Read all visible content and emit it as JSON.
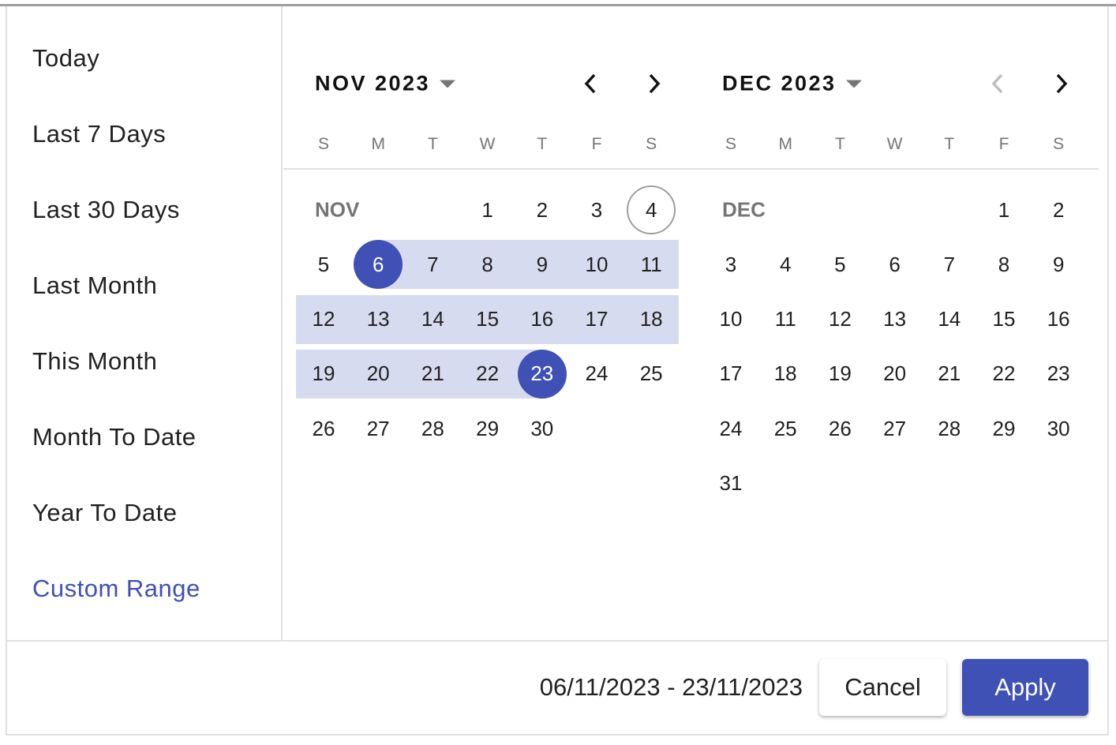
{
  "presets": [
    "Today",
    "Last 7 Days",
    "Last 30 Days",
    "Last Month",
    "This Month",
    "Month To Date",
    "Year To Date",
    "Custom Range"
  ],
  "active_preset": "Custom Range",
  "weekdays": [
    "S",
    "M",
    "T",
    "W",
    "T",
    "F",
    "S"
  ],
  "months": [
    {
      "title": "NOV 2023",
      "label": "NOV",
      "first_weekday": 3,
      "days": 30,
      "prev_enabled": true,
      "next_enabled": true
    },
    {
      "title": "DEC 2023",
      "label": "DEC",
      "first_weekday": 5,
      "days": 31,
      "prev_enabled": false,
      "next_enabled": true
    }
  ],
  "selection": {
    "month": "NOV 2023",
    "start": 6,
    "end": 23,
    "today": 4
  },
  "footer": {
    "range_text": "06/11/2023 - 23/11/2023",
    "cancel_label": "Cancel",
    "apply_label": "Apply"
  },
  "colors": {
    "accent": "#3f51b5",
    "range": "#d7dbf0"
  }
}
